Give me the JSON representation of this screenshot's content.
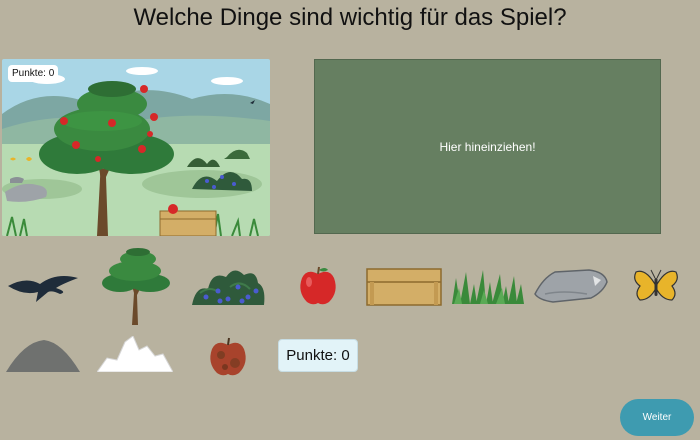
{
  "title": "Welche Dinge sind wichtig für das Spiel?",
  "scene": {
    "score_label": "Punkte: 0"
  },
  "dropzone": {
    "label": "Hier hineinziehen!"
  },
  "score": {
    "label": "Punkte: 0"
  },
  "next_button": {
    "label": "Weiter"
  },
  "items": [
    {
      "name": "bird",
      "icon": "bird-icon"
    },
    {
      "name": "apple-tree",
      "icon": "tree-icon"
    },
    {
      "name": "blueberry-bush",
      "icon": "bush-icon"
    },
    {
      "name": "red-apple",
      "icon": "apple-icon"
    },
    {
      "name": "wooden-crate",
      "icon": "crate-icon"
    },
    {
      "name": "grass",
      "icon": "grass-icon"
    },
    {
      "name": "stone",
      "icon": "stone-icon"
    },
    {
      "name": "butterfly",
      "icon": "butterfly-icon"
    },
    {
      "name": "gray-mountain",
      "icon": "mountain-icon"
    },
    {
      "name": "snow-mountain",
      "icon": "snow-mountain-icon"
    },
    {
      "name": "rotten-apple",
      "icon": "rotten-apple-icon"
    }
  ],
  "colors": {
    "background": "#b8b29f",
    "dropzone": "#667f61",
    "next_button": "#3e9bb0",
    "score_box": "#e2f3f8"
  }
}
